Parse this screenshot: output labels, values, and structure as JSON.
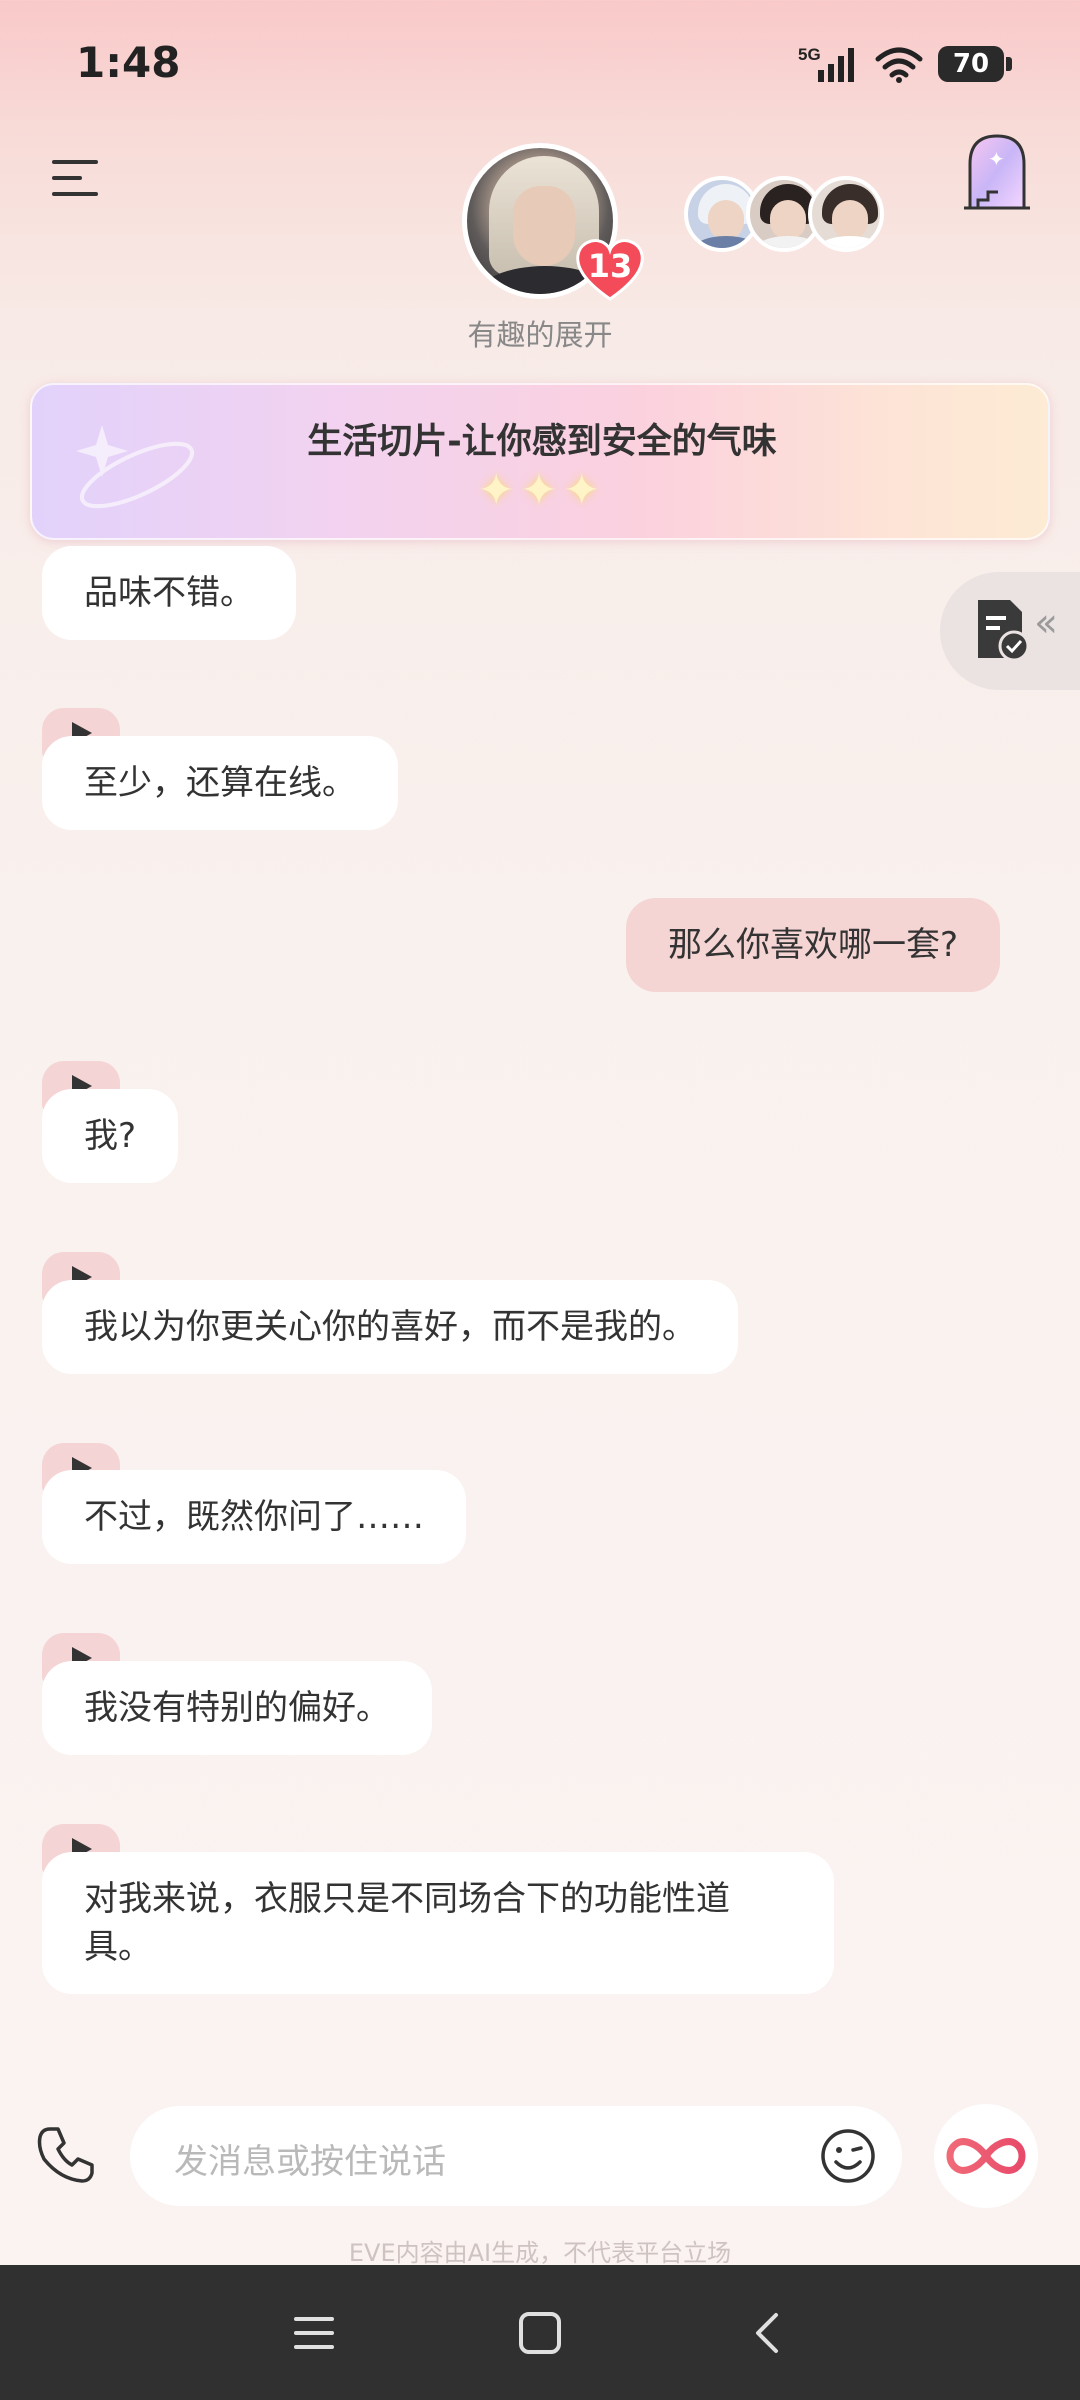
{
  "status_bar": {
    "time": "1:48",
    "network": "5G",
    "battery": "70"
  },
  "header": {
    "unread_count": "13",
    "subtitle": "有趣的展开"
  },
  "banner": {
    "title": "生活切片-让你感到安全的气味",
    "stars": "✦✦✦"
  },
  "messages": [
    {
      "from": "ai",
      "text": "品味不错。"
    },
    {
      "from": "ai",
      "text": "至少，还算在线。"
    },
    {
      "from": "user",
      "text": "那么你喜欢哪一套?"
    },
    {
      "from": "ai",
      "text": "我?"
    },
    {
      "from": "ai",
      "text": "我以为你更关心你的喜好，而不是我的。"
    },
    {
      "from": "ai",
      "text": "不过，既然你问了……"
    },
    {
      "from": "ai",
      "text": "我没有特别的偏好。"
    },
    {
      "from": "ai",
      "text": "对我来说，衣服只是不同场合下的功能性道具。"
    }
  ],
  "composer": {
    "placeholder": "发消息或按住说话"
  },
  "disclaimer": "EVE内容由AI生成，不代表平台立场",
  "icons": [
    "menu-icon",
    "heart-badge-icon",
    "door-icon",
    "document-check-icon",
    "collapse-arrows-icon",
    "play-icon",
    "phone-icon",
    "emoji-icon",
    "infinity-icon",
    "nav-menu-icon",
    "nav-home-icon",
    "nav-back-icon"
  ],
  "colors": {
    "accent": "#f44b5a",
    "user_bubble": "#f5d4d4",
    "play_bg": "#f4d4d4"
  }
}
